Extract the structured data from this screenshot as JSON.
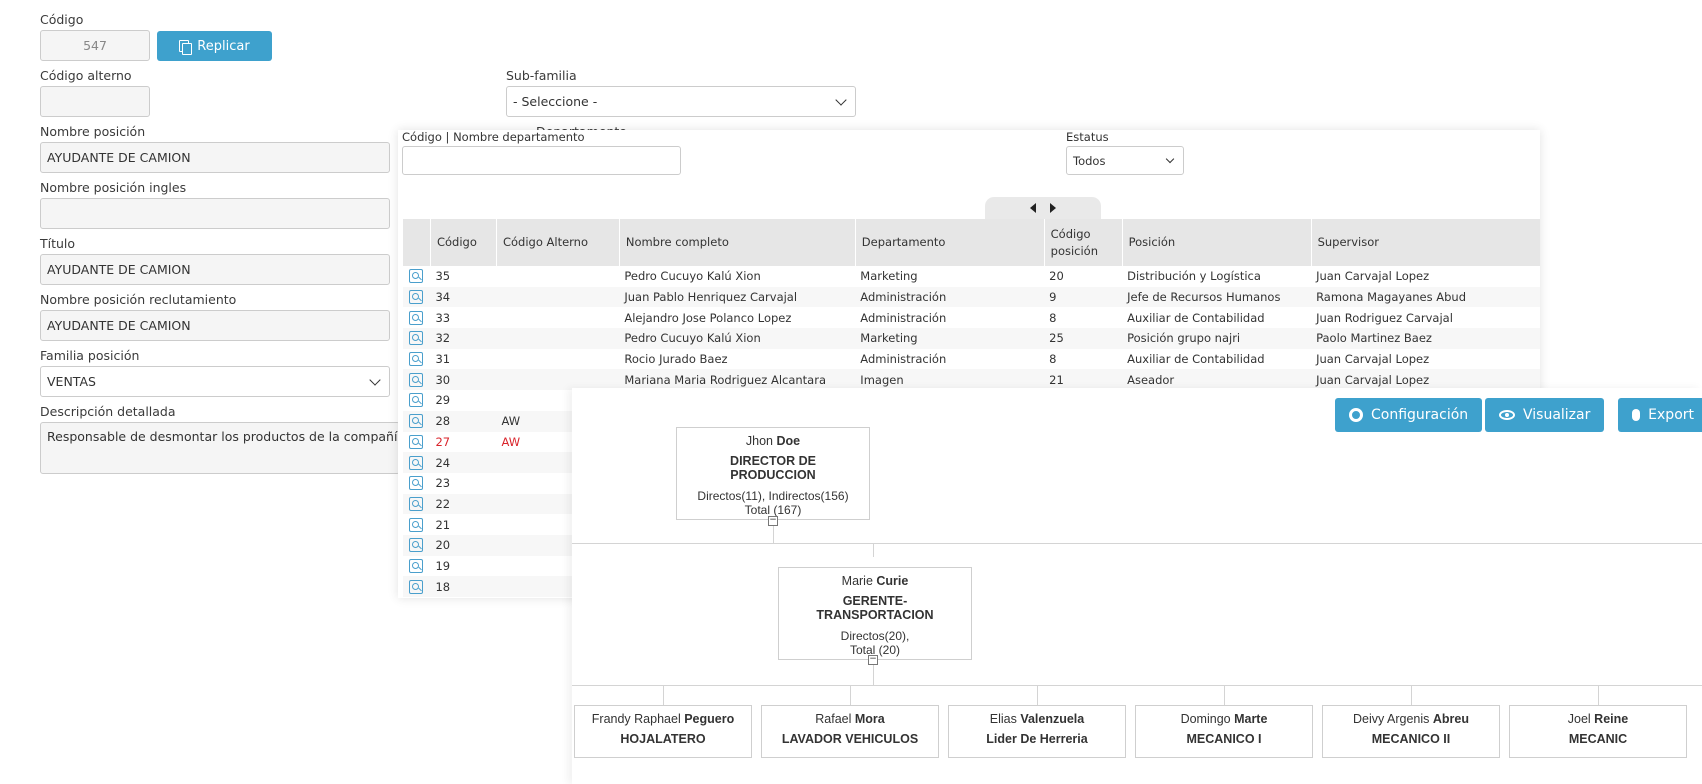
{
  "form": {
    "codigo_label": "Código",
    "codigo_value": "547",
    "replicar_label": "Replicar",
    "codigo_alterno_label": "Código alterno",
    "codigo_alterno_value": "",
    "subfamilia_label": "Sub-familia",
    "subfamilia_value": "- Seleccione -",
    "departamento_label": "Departamento",
    "nombre_posicion_label": "Nombre posición",
    "nombre_posicion_value": "AYUDANTE DE CAMION",
    "nombre_ingles_label": "Nombre posición ingles",
    "nombre_ingles_value": "",
    "titulo_label": "Título",
    "titulo_value": "AYUDANTE DE CAMION",
    "reclutamiento_label": "Nombre posición reclutamiento",
    "reclutamiento_value": "AYUDANTE DE CAMION",
    "familia_label": "Familia posición",
    "familia_value": "VENTAS",
    "descripcion_label": "Descripción detallada",
    "descripcion_value": "Responsable de desmontar los productos de la compañía al"
  },
  "dept_panel": {
    "search_label": "Código | Nombre departamento",
    "estatus_label": "Estatus",
    "estatus_value": "Todos",
    "columns": [
      "",
      "Código",
      "Código Alterno",
      "Nombre completo",
      "Departamento",
      "Código posición",
      "Posición",
      "Supervisor"
    ],
    "rows": [
      {
        "codigo": "35",
        "alterno": "",
        "nombre": "Pedro Cucuyo Kalú Xion",
        "departamento": "Marketing",
        "cod_pos": "20",
        "posicion": "Distribución y Logística",
        "supervisor": "Juan Carvajal Lopez"
      },
      {
        "codigo": "34",
        "alterno": "",
        "nombre": "Juan Pablo Henriquez Carvajal",
        "departamento": "Administración",
        "cod_pos": "9",
        "posicion": "Jefe de Recursos Humanos",
        "supervisor": "Ramona Magayanes Abud"
      },
      {
        "codigo": "33",
        "alterno": "",
        "nombre": "Alejandro Jose Polanco Lopez",
        "departamento": "Administración",
        "cod_pos": "8",
        "posicion": "Auxiliar de Contabilidad",
        "supervisor": "Juan Rodriguez Carvajal"
      },
      {
        "codigo": "32",
        "alterno": "",
        "nombre": "Pedro Cucuyo Kalú Xion",
        "departamento": "Marketing",
        "cod_pos": "25",
        "posicion": "Posición grupo najri",
        "supervisor": "Paolo Martinez Baez"
      },
      {
        "codigo": "31",
        "alterno": "",
        "nombre": "Rocio Jurado Baez",
        "departamento": "Administración",
        "cod_pos": "8",
        "posicion": "Auxiliar de Contabilidad",
        "supervisor": "Juan Carvajal Lopez"
      },
      {
        "codigo": "30",
        "alterno": "",
        "nombre": "Mariana Maria Rodriguez Alcantara",
        "departamento": "Imagen",
        "cod_pos": "21",
        "posicion": "Aseador",
        "supervisor": "Juan Carvajal Lopez"
      },
      {
        "codigo": "29",
        "alterno": "",
        "nombre": "",
        "departamento": "",
        "cod_pos": "",
        "posicion": "",
        "supervisor": ""
      },
      {
        "codigo": "28",
        "alterno": "AW",
        "nombre": "",
        "departamento": "",
        "cod_pos": "",
        "posicion": "",
        "supervisor": ""
      },
      {
        "codigo": "27",
        "alterno": "AW",
        "nombre": "",
        "departamento": "",
        "cod_pos": "",
        "posicion": "",
        "supervisor": "",
        "highlight": true
      },
      {
        "codigo": "24",
        "alterno": "",
        "nombre": "",
        "departamento": "",
        "cod_pos": "",
        "posicion": "",
        "supervisor": ""
      },
      {
        "codigo": "23",
        "alterno": "",
        "nombre": "",
        "departamento": "",
        "cod_pos": "",
        "posicion": "",
        "supervisor": ""
      },
      {
        "codigo": "22",
        "alterno": "",
        "nombre": "",
        "departamento": "",
        "cod_pos": "",
        "posicion": "",
        "supervisor": ""
      },
      {
        "codigo": "21",
        "alterno": "",
        "nombre": "",
        "departamento": "",
        "cod_pos": "",
        "posicion": "",
        "supervisor": ""
      },
      {
        "codigo": "20",
        "alterno": "",
        "nombre": "",
        "departamento": "",
        "cod_pos": "",
        "posicion": "",
        "supervisor": ""
      },
      {
        "codigo": "19",
        "alterno": "",
        "nombre": "",
        "departamento": "",
        "cod_pos": "",
        "posicion": "",
        "supervisor": ""
      },
      {
        "codigo": "18",
        "alterno": "",
        "nombre": "",
        "departamento": "",
        "cod_pos": "",
        "posicion": "",
        "supervisor": ""
      }
    ]
  },
  "org_chart": {
    "buttons": {
      "configuracion": "Configuración",
      "visualizar": "Visualizar",
      "exportar": "Export"
    },
    "root": {
      "first": "Jhon ",
      "last": "Doe",
      "title": "DIRECTOR DE PRODUCCION",
      "stats1": "Directos(11), Indirectos(156)",
      "stats2": "Total (167)"
    },
    "manager": {
      "first": "Marie ",
      "last": "Curie",
      "title": "GERENTE-TRANSPORTACION",
      "stats1": "Directos(20),",
      "stats2": "Total (20)"
    },
    "children": [
      {
        "first": "Frandy Raphael ",
        "last": "Peguero",
        "title": "HOJALATERO"
      },
      {
        "first": "Rafael ",
        "last": "Mora",
        "title": "LAVADOR VEHICULOS"
      },
      {
        "first": "Elias ",
        "last": "Valenzuela",
        "title": "Lider De Herreria"
      },
      {
        "first": "Domingo ",
        "last": "Marte",
        "title": "MECANICO I"
      },
      {
        "first": "Deivy Argenis ",
        "last": "Abreu",
        "title": "MECANICO II"
      },
      {
        "first": "Joel ",
        "last": "Reine",
        "title": "MECANIC"
      }
    ]
  }
}
